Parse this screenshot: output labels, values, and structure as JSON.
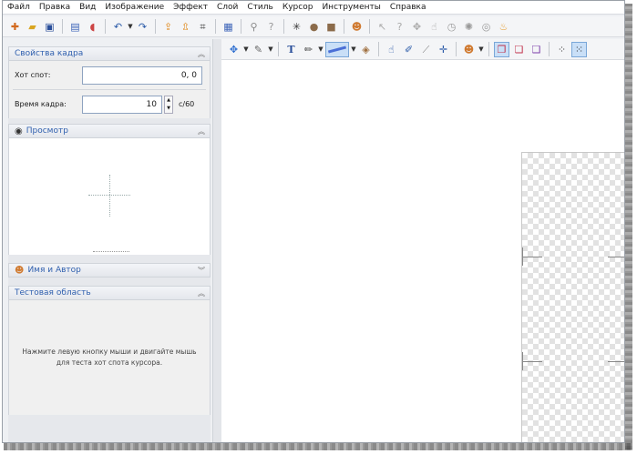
{
  "menu": [
    "Файл",
    "Правка",
    "Вид",
    "Изображение",
    "Эффект",
    "Слой",
    "Стиль",
    "Курсор",
    "Инструменты",
    "Справка"
  ],
  "toolbar1": {
    "icons": [
      "new-file-icon",
      "open-folder-icon",
      "save-icon",
      "import-icon",
      "sound-icon",
      "undo-icon",
      "redo-icon",
      "export-icon",
      "export-alt-icon",
      "crop-icon",
      "layers-icon",
      "magnifier-icon",
      "help-cursor-icon",
      "effect-icon",
      "circle-icon",
      "rounded-icon",
      "person-icon",
      "arrow-cursor-icon",
      "question-cursor-icon",
      "move-cursor-icon",
      "hand-cursor-icon",
      "clock-cursor-icon",
      "busy-cursor-icon",
      "ring-icon",
      "fire-icon"
    ]
  },
  "toolbar2": {
    "icons": [
      "move-tool-icon",
      "pen-tool-icon",
      "text-tool-icon",
      "pencil-tool-icon",
      "line-tool-icon",
      "fill-tool-icon",
      "hand-pointer-icon",
      "brush-tool-icon",
      "eyedropper-icon",
      "crosshair-icon",
      "person-tool-icon",
      "layer-front-icon",
      "layer-back-icon",
      "layer-merge-icon",
      "dots-grid-icon",
      "dots-grid-active-icon"
    ]
  },
  "frame_props": {
    "title": "Свойства кадра",
    "hotspot_label": "Хот спот:",
    "hotspot_value": "0, 0",
    "frame_time_label": "Время кадра:",
    "frame_time_value": "10",
    "frame_time_unit": "с/60"
  },
  "preview": {
    "title": "Просмотр"
  },
  "name_author": {
    "title": "Имя и Автор"
  },
  "test_area": {
    "title": "Тестовая область",
    "hint": "Нажмите левую кнопку мыши и двигайте мышь для теста хот спота курсора."
  },
  "colors": {
    "accent": "#2f5fae",
    "active_tool": "#c9dff7"
  }
}
